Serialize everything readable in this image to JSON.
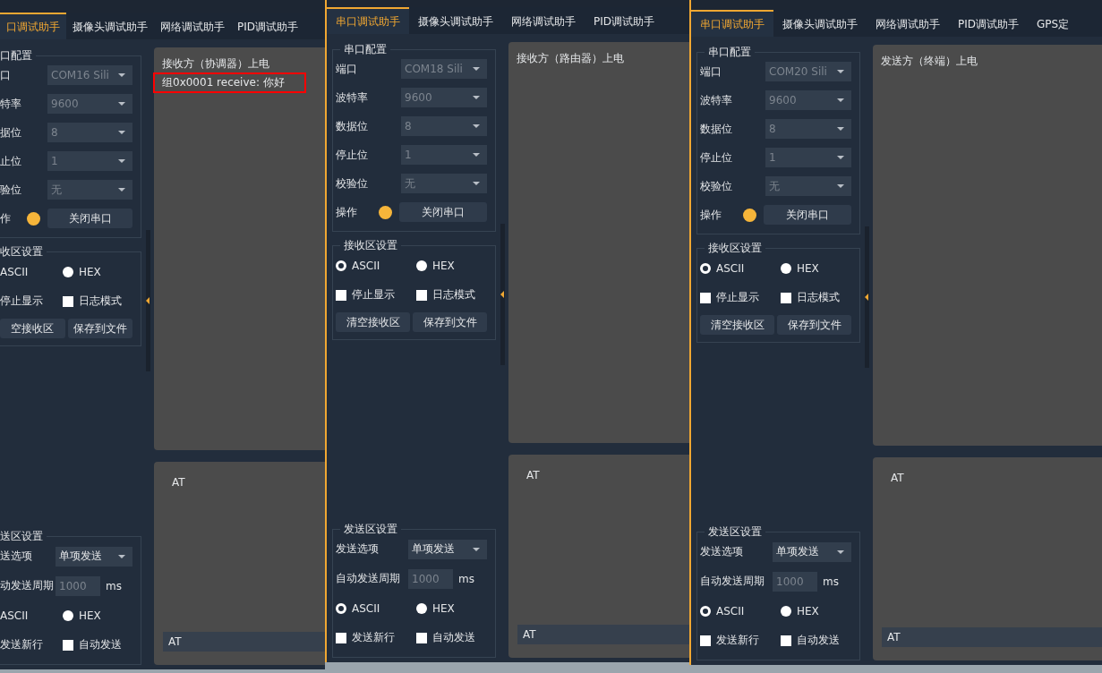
{
  "windows": [
    {
      "tabs": [
        {
          "label": "口调试助手",
          "selected": true
        },
        {
          "label": "摄像头调试助手",
          "selected": false
        },
        {
          "label": "网络调试助手",
          "selected": false
        },
        {
          "label": "PID调试助手",
          "selected": false
        }
      ],
      "serial_config": {
        "title": "口配置",
        "fields": [
          {
            "label": "口",
            "value": "COM16 Sili",
            "disabled": true
          },
          {
            "label": "特率",
            "value": "9600",
            "disabled": true
          },
          {
            "label": "据位",
            "value": "8",
            "disabled": true
          },
          {
            "label": "止位",
            "value": "1",
            "disabled": true
          },
          {
            "label": "验位",
            "value": "无",
            "disabled": true
          }
        ],
        "operation": {
          "label": "作",
          "port_open": true,
          "button": "关闭串口"
        }
      },
      "receive_settings": {
        "title": "收区设置",
        "options": [
          {
            "label": "ASCII"
          },
          {
            "label": "HEX",
            "selected": false
          }
        ],
        "checks": [
          {
            "label": "停止显示"
          },
          {
            "label": "日志模式",
            "checked": false
          }
        ],
        "buttons": [
          "空接收区",
          "保存到文件"
        ]
      },
      "receive_lines": [
        {
          "text": "接收方（协调器）上电",
          "highlighted": false
        },
        {
          "text": "组0x0001 receive: 你好",
          "highlighted": true
        }
      ],
      "send_text": "AT",
      "send_input": "AT",
      "send_settings": {
        "title": "送区设置",
        "mode": {
          "label": "送选项",
          "value": "单项发送",
          "disabled": false
        },
        "interval": {
          "label": "动发送周期",
          "placeholder": "1000",
          "unit": "ms"
        },
        "options": [
          {
            "label": "ASCII"
          },
          {
            "label": "HEX",
            "selected": false
          }
        ],
        "checks": [
          {
            "label": "发送新行"
          },
          {
            "label": "自动发送",
            "checked": false
          }
        ]
      }
    },
    {
      "tabs": [
        {
          "label": "串口调试助手",
          "selected": true
        },
        {
          "label": "摄像头调试助手",
          "selected": false
        },
        {
          "label": "网络调试助手",
          "selected": false
        },
        {
          "label": "PID调试助手",
          "selected": false
        }
      ],
      "serial_config": {
        "title": "串口配置",
        "fields": [
          {
            "label": "端口",
            "value": "COM18 Sili",
            "disabled": true
          },
          {
            "label": "波特率",
            "value": "9600",
            "disabled": true
          },
          {
            "label": "数据位",
            "value": "8",
            "disabled": true
          },
          {
            "label": "停止位",
            "value": "1",
            "disabled": true
          },
          {
            "label": "校验位",
            "value": "无",
            "disabled": true
          }
        ],
        "operation": {
          "label": "操作",
          "port_open": true,
          "button": "关闭串口"
        }
      },
      "receive_settings": {
        "title": "接收区设置",
        "options": [
          {
            "label": "ASCII",
            "selected": true
          },
          {
            "label": "HEX",
            "selected": false
          }
        ],
        "checks": [
          {
            "label": "停止显示",
            "checked": false
          },
          {
            "label": "日志模式",
            "checked": false
          }
        ],
        "buttons": [
          "清空接收区",
          "保存到文件"
        ]
      },
      "receive_lines": [
        {
          "text": "接收方（路由器）上电",
          "highlighted": false
        }
      ],
      "send_text": "AT",
      "send_input": "AT",
      "send_settings": {
        "title": "发送区设置",
        "mode": {
          "label": "发送选项",
          "value": "单项发送",
          "disabled": false
        },
        "interval": {
          "label": "自动发送周期",
          "placeholder": "1000",
          "unit": "ms"
        },
        "options": [
          {
            "label": "ASCII",
            "selected": true
          },
          {
            "label": "HEX",
            "selected": false
          }
        ],
        "checks": [
          {
            "label": "发送新行",
            "checked": false
          },
          {
            "label": "自动发送",
            "checked": false
          }
        ]
      }
    },
    {
      "tabs": [
        {
          "label": "串口调试助手",
          "selected": true
        },
        {
          "label": "摄像头调试助手",
          "selected": false
        },
        {
          "label": "网络调试助手",
          "selected": false
        },
        {
          "label": "PID调试助手",
          "selected": false
        },
        {
          "label": "GPS定",
          "selected": false
        }
      ],
      "serial_config": {
        "title": "串口配置",
        "fields": [
          {
            "label": "端口",
            "value": "COM20 Sili",
            "disabled": true
          },
          {
            "label": "波特率",
            "value": "9600",
            "disabled": true
          },
          {
            "label": "数据位",
            "value": "8",
            "disabled": true
          },
          {
            "label": "停止位",
            "value": "1",
            "disabled": true
          },
          {
            "label": "校验位",
            "value": "无",
            "disabled": true
          }
        ],
        "operation": {
          "label": "操作",
          "port_open": true,
          "button": "关闭串口"
        }
      },
      "receive_settings": {
        "title": "接收区设置",
        "options": [
          {
            "label": "ASCII",
            "selected": true
          },
          {
            "label": "HEX",
            "selected": false
          }
        ],
        "checks": [
          {
            "label": "停止显示",
            "checked": false
          },
          {
            "label": "日志模式",
            "checked": false
          }
        ],
        "buttons": [
          "清空接收区",
          "保存到文件"
        ]
      },
      "receive_lines": [
        {
          "text": "发送方（终端）上电",
          "highlighted": false
        }
      ],
      "send_text": "AT",
      "send_input": "AT",
      "send_settings": {
        "title": "发送区设置",
        "mode": {
          "label": "发送选项",
          "value": "单项发送",
          "disabled": false
        },
        "interval": {
          "label": "自动发送周期",
          "placeholder": "1000",
          "unit": "ms"
        },
        "options": [
          {
            "label": "ASCII",
            "selected": true
          },
          {
            "label": "HEX",
            "selected": false
          }
        ],
        "checks": [
          {
            "label": "发送新行",
            "checked": false
          },
          {
            "label": "自动发送",
            "checked": false
          }
        ]
      }
    }
  ]
}
